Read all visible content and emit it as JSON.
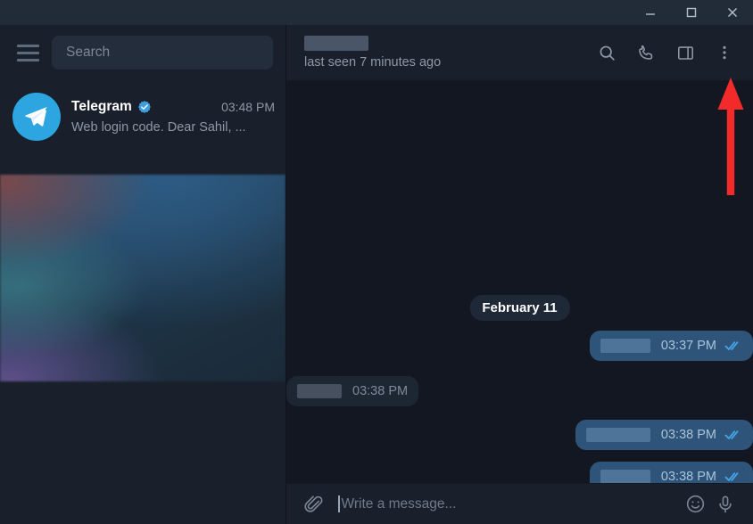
{
  "window": {
    "minimize_label": "Minimize",
    "maximize_label": "Maximize",
    "close_label": "Close"
  },
  "sidebar": {
    "menu_icon": "hamburger-menu-icon",
    "search": {
      "placeholder": "Search",
      "value": ""
    },
    "chats": [
      {
        "name": "Telegram",
        "verified": true,
        "time": "03:48 PM",
        "preview": "Web login code. Dear Sahil, ...",
        "avatar_icon": "telegram-paper-plane-icon",
        "avatar_color": "#2ca5e0"
      }
    ],
    "media_preview": {
      "label": "blurred-gradient-preview"
    }
  },
  "chat_header": {
    "title_redacted": true,
    "title": "",
    "status": "last seen 7 minutes ago",
    "actions": [
      {
        "icon": "search-icon",
        "label": "Search messages"
      },
      {
        "icon": "phone-icon",
        "label": "Call"
      },
      {
        "icon": "panel-toggle-icon",
        "label": "Toggle info panel"
      },
      {
        "icon": "three-dots-menu-icon",
        "label": "More options"
      }
    ]
  },
  "conversation": {
    "date_separator": "February 11",
    "messages": [
      {
        "direction": "out",
        "text_redacted": true,
        "time": "03:37 PM",
        "status_icon": "double-check-icon",
        "redact_width": 56
      },
      {
        "direction": "in",
        "text_redacted": true,
        "time": "03:38 PM",
        "status_icon": "",
        "redact_width": 50
      },
      {
        "direction": "out",
        "text_redacted": true,
        "time": "03:38 PM",
        "status_icon": "double-check-icon",
        "redact_width": 72
      },
      {
        "direction": "out",
        "text_redacted": true,
        "time": "03:38 PM",
        "status_icon": "double-check-icon",
        "redact_width": 56
      }
    ]
  },
  "composer": {
    "attach_icon": "paperclip-icon",
    "placeholder": "Write a message...",
    "value": "",
    "emoji_icon": "smiley-icon",
    "voice_icon": "microphone-icon"
  },
  "annotation": {
    "arrow_color": "#f22a2a",
    "points_at": "three-dots-menu-icon",
    "direction": "up"
  },
  "colors": {
    "sidebar_bg": "#1a202b",
    "chat_bg": "#131722",
    "titlebar_bg": "#222b38",
    "bubble_out": "#2f5479",
    "bubble_in": "#1d2633",
    "accent": "#2ca5e0",
    "tick": "#45a4e6"
  }
}
